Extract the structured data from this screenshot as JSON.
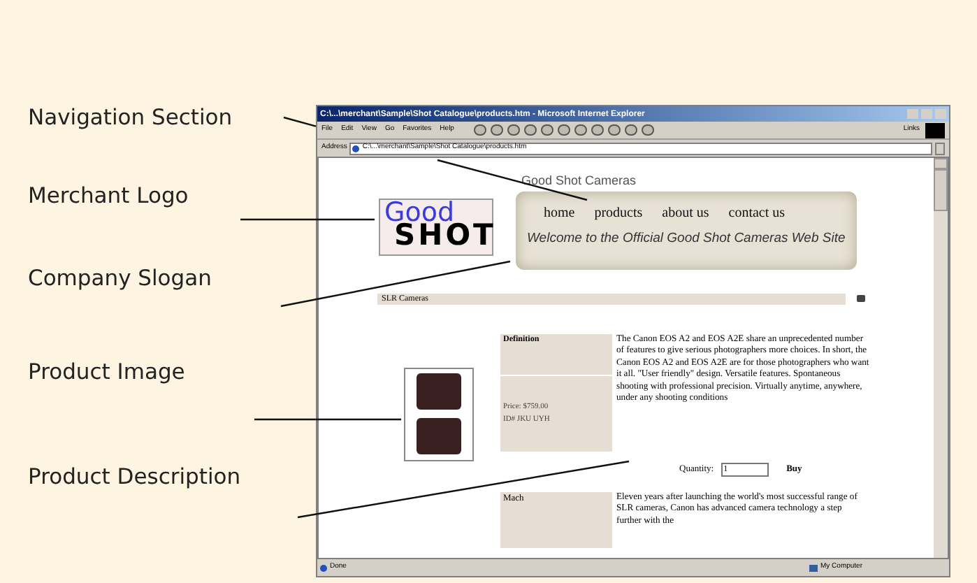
{
  "annotations": [
    {
      "label": "Navigation Section"
    },
    {
      "label": "Merchant Logo"
    },
    {
      "label": "Company Slogan"
    },
    {
      "label": "Product Image"
    },
    {
      "label": "Product Description"
    }
  ],
  "browser": {
    "title": "C:\\...\\merchant\\Sample\\Shot Catalogue\\products.htm - Microsoft Internet Explorer",
    "menu": [
      "File",
      "Edit",
      "View",
      "Go",
      "Favorites",
      "Help"
    ],
    "links_label": "Links",
    "address_label": "Address",
    "address": "C:\\...\\merchant\\Sample\\Shot Catalogue\\products.htm",
    "status": "Done",
    "zone": "My Computer"
  },
  "page": {
    "site_name": "Good Shot Cameras",
    "logo": {
      "word_1": "Good",
      "word_2": "SHOT"
    },
    "nav": [
      "home",
      "products",
      "about us",
      "contact us"
    ],
    "slogan": "Welcome to the Official Good Shot Cameras Web Site",
    "category": "SLR Cameras",
    "product": {
      "definition_label": "Definition",
      "price_lines": [
        "Price: $759.00",
        "ID# JKU UYH"
      ],
      "description": "The Canon EOS A2 and EOS A2E share an unprecedented number of features to give serious photographers more choices. In short, the Canon EOS A2 and EOS A2E are for those photographers who want it all. \"User friendly\" design. Versatile features. Spontaneous shooting with professional precision. Virtually anytime, anywhere, under any shooting conditions",
      "quantity_label": "Quantity:",
      "quantity_value": "1",
      "buy": "Buy"
    },
    "next_product": {
      "label": "Mach",
      "description": "Eleven years after launching the world's most successful range of SLR cameras, Canon has advanced camera technology a step further with the"
    }
  }
}
